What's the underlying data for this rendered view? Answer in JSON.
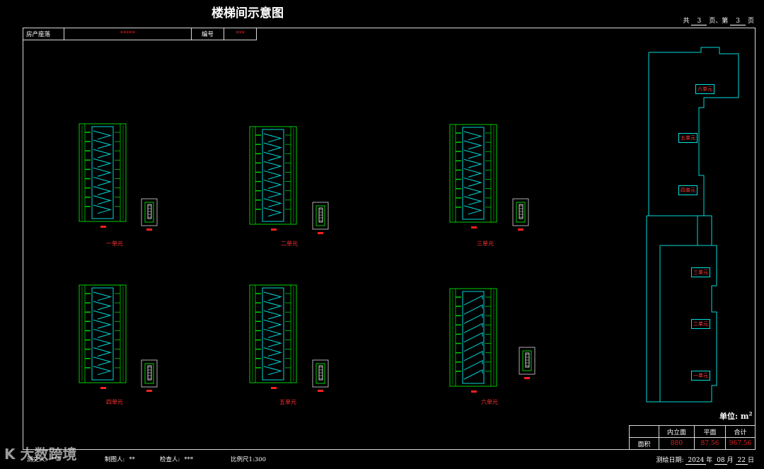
{
  "title": "楼梯间示意图",
  "page_info": {
    "total_prefix": "共",
    "total": "3",
    "total_suffix": "页、第",
    "current": "3",
    "current_suffix": "页"
  },
  "info_table": {
    "location_label": "房产座落",
    "location_value": "*****",
    "number_label": "编号",
    "number_value": "***"
  },
  "units": [
    {
      "name": "一单元"
    },
    {
      "name": "二单元"
    },
    {
      "name": "三单元"
    },
    {
      "name": "四单元"
    },
    {
      "name": "五单元"
    },
    {
      "name": "六单元"
    }
  ],
  "site_plan": {
    "labels": [
      "六单元",
      "五单元",
      "四单元",
      "三单元",
      "二单元",
      "一单元"
    ]
  },
  "unit_mark": {
    "label": "单位:",
    "unit": "m",
    "sup": "2"
  },
  "area_table": {
    "headers": [
      "",
      "内立面",
      "平面",
      "合计"
    ],
    "row_label": "面积",
    "values": [
      "880",
      "87.56",
      "967.56"
    ]
  },
  "footer": {
    "surveyor_label": "测丈人:",
    "surveyor_value": "***",
    "drafter_label": "制图人:",
    "drafter_value": "**",
    "checker_label": "检查人:",
    "checker_value": "***",
    "scale_label": "比例尺1:300",
    "date_label": "测绘日期:",
    "date_year": "2024",
    "date_year_suffix": "年",
    "date_month": "08",
    "date_month_suffix": "月",
    "date_day": "22",
    "date_day_suffix": "日"
  },
  "watermark": "K 大数跨境",
  "colors": {
    "cad_green": "#00d000",
    "cad_cyan": "#00d8d8",
    "cad_red": "#ff2020",
    "background": "#000000",
    "frame": "#d8d8d8"
  }
}
